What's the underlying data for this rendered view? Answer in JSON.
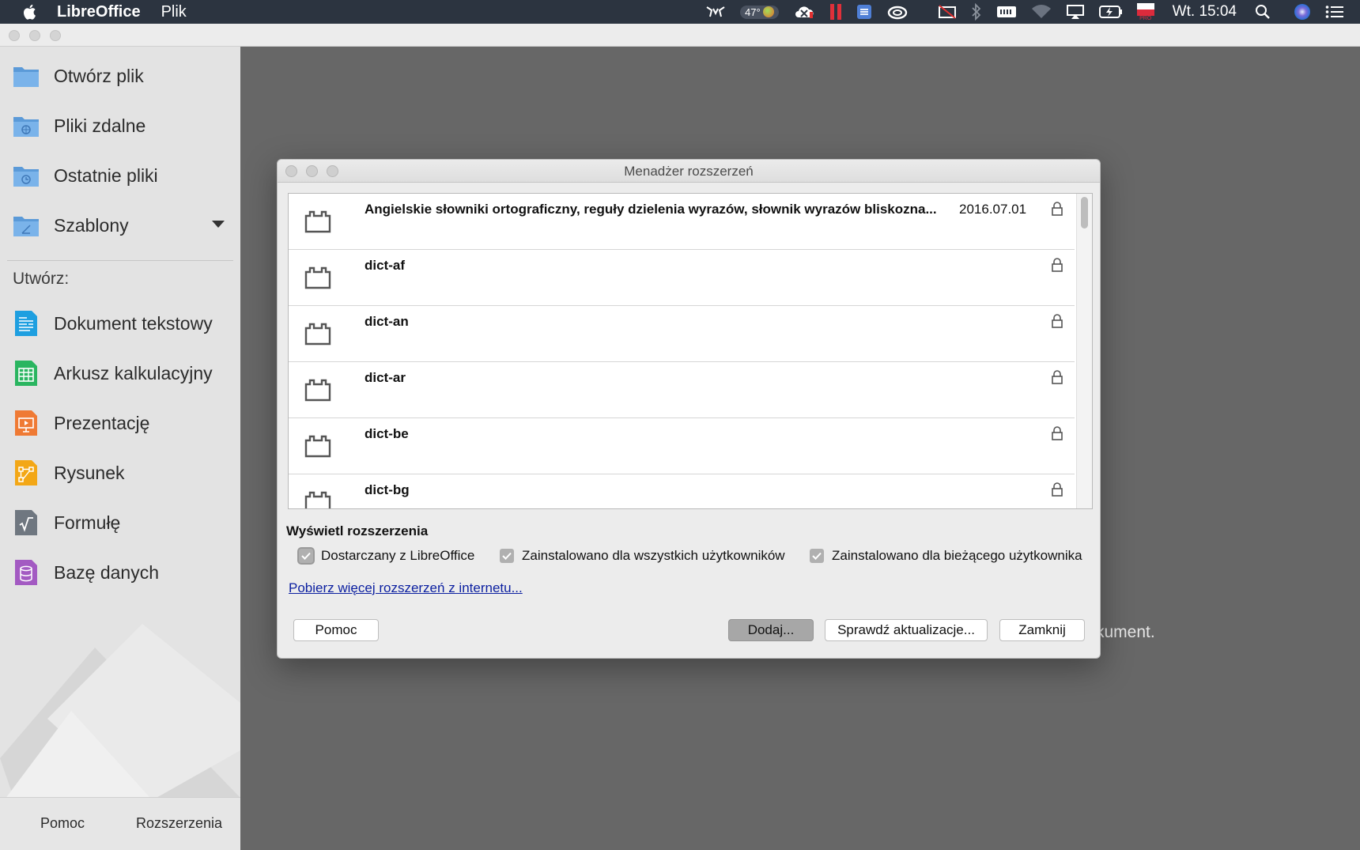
{
  "menubar": {
    "app_name": "LibreOffice",
    "menu_file": "Plik",
    "battery_temp": "47°",
    "clock": "Wt. 15:04",
    "flag_badge": "PRO"
  },
  "sidebar": {
    "items": [
      {
        "label": "Otwórz plik",
        "icon": "folder-icon"
      },
      {
        "label": "Pliki zdalne",
        "icon": "remote-folder-icon"
      },
      {
        "label": "Ostatnie pliki",
        "icon": "recent-folder-icon"
      },
      {
        "label": "Szablony",
        "icon": "templates-folder-icon"
      }
    ],
    "create_label": "Utwórz:",
    "create_items": [
      {
        "label": "Dokument tekstowy",
        "icon": "writer-icon",
        "color": "#1e9fe0"
      },
      {
        "label": "Arkusz kalkulacyjny",
        "icon": "calc-icon",
        "color": "#2ab560"
      },
      {
        "label": "Prezentację",
        "icon": "impress-icon",
        "color": "#ef7a34"
      },
      {
        "label": "Rysunek",
        "icon": "draw-icon",
        "color": "#f3a716"
      },
      {
        "label": "Formułę",
        "icon": "math-icon",
        "color": "#6f7780"
      },
      {
        "label": "Bazę danych",
        "icon": "base-icon",
        "color": "#a35ac2"
      }
    ],
    "help_label": "Pomoc",
    "extensions_label": "Rozszerzenia"
  },
  "background_text": "kument.",
  "dialog": {
    "title": "Menadżer rozszerzeń",
    "extensions": [
      {
        "name": "Angielskie słowniki ortograficzny, reguły dzielenia wyrazów, słownik wyrazów bliskozna...",
        "version": "2016.07.01"
      },
      {
        "name": "dict-af",
        "version": ""
      },
      {
        "name": "dict-an",
        "version": ""
      },
      {
        "name": "dict-ar",
        "version": ""
      },
      {
        "name": "dict-be",
        "version": ""
      },
      {
        "name": "dict-bg",
        "version": ""
      }
    ],
    "show_label": "Wyświetl rozszerzenia",
    "checkboxes": [
      {
        "label": "Dostarczany z LibreOffice",
        "checked": true
      },
      {
        "label": "Zainstalowano dla wszystkich użytkowników",
        "checked": true
      },
      {
        "label": "Zainstalowano dla bieżącego użytkownika",
        "checked": true
      }
    ],
    "link_label": "Pobierz więcej rozszerzeń z internetu...",
    "buttons": {
      "help": "Pomoc",
      "add": "Dodaj...",
      "check_updates": "Sprawdź aktualizacje...",
      "close": "Zamknij"
    }
  }
}
